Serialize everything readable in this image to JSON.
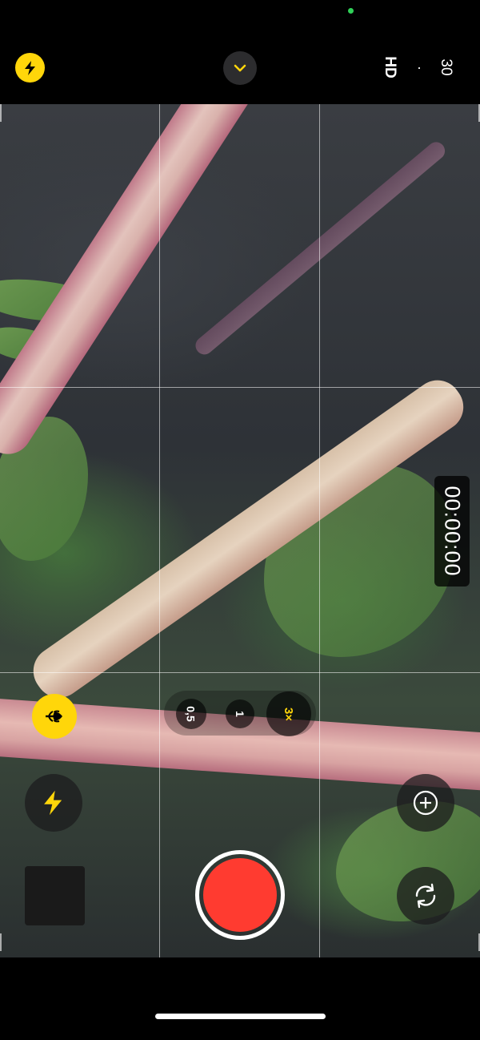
{
  "top_bar": {
    "format_label": "HD",
    "separator": "·",
    "fps_label": "30",
    "flash_icon": "bolt-circle-icon",
    "controls_icon": "chevron-down-icon"
  },
  "viewfinder": {
    "timer": "00:00:00"
  },
  "controls": {
    "macro_icon": "tulip-icon",
    "zoom_options": [
      "0,5",
      "1",
      "3×"
    ],
    "selected_zoom": "3×",
    "flash_icon": "bolt-icon",
    "exposure_icon": "exposure-plus-icon",
    "switch_camera_icon": "switch-camera-icon",
    "shutter_icon": "record-button"
  },
  "colors": {
    "accent": "#ffd60a",
    "record": "#ff3b30",
    "camera_in_use_dot": "#30d158"
  }
}
